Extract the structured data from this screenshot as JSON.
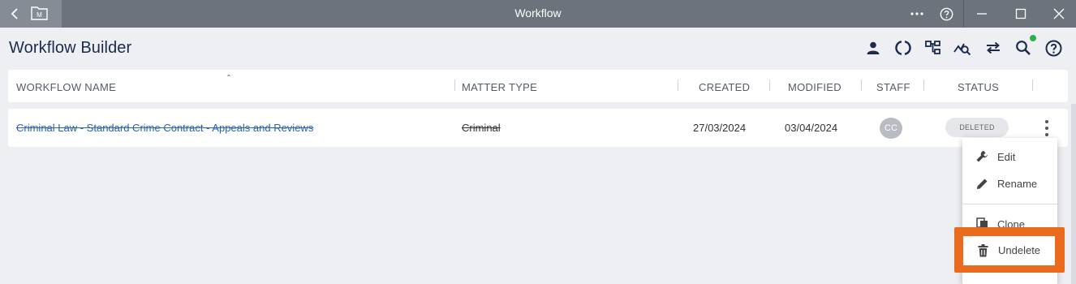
{
  "window": {
    "title": "Workflow",
    "back_icon": "chevron-left-icon",
    "app_icon": "folder-m-icon",
    "folder_letter": "M",
    "more_icon": "more-horizontal-icon",
    "help_icon": "help-circle-icon",
    "minimize_icon": "minimize-icon",
    "maximize_icon": "maximize-icon",
    "close_icon": "close-icon"
  },
  "header": {
    "title": "Workflow Builder",
    "icons": [
      "person-icon",
      "circle-refresh-icon",
      "org-chart-icon",
      "analytics-search-icon",
      "swap-arrows-icon",
      "search-icon",
      "help-circle-icon"
    ],
    "notification_color": "#2db04b"
  },
  "table": {
    "columns": [
      "WORKFLOW NAME",
      "MATTER TYPE",
      "CREATED",
      "MODIFIED",
      "STAFF",
      "STATUS"
    ],
    "sort_indicator": "ˆ",
    "rows": [
      {
        "name": "Criminal Law - Standard Crime Contract - Appeals and Reviews",
        "matter_type": "Criminal",
        "created": "27/03/2024",
        "modified": "03/04/2024",
        "staff": "CC",
        "status": "DELETED"
      }
    ]
  },
  "context_menu": {
    "items": [
      {
        "label": "Edit",
        "icon": "wrench-icon"
      },
      {
        "label": "Rename",
        "icon": "pencil-icon"
      },
      {
        "label": "Clone",
        "icon": "copy-icon"
      },
      {
        "label": "Undelete",
        "icon": "trash-icon"
      }
    ],
    "highlight_color": "#ea6b1e"
  }
}
